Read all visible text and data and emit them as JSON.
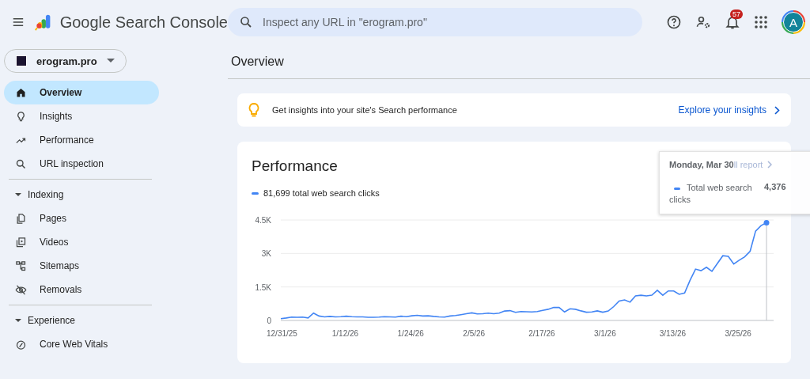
{
  "header": {
    "app_title": "Google Search Console",
    "search": {
      "placeholder": "Inspect any URL in \"erogram.pro\""
    },
    "notifications": {
      "count": "57"
    },
    "avatar": {
      "initial": "A"
    }
  },
  "sidebar": {
    "property": "erogram.pro",
    "items": [
      {
        "label": "Overview",
        "selected": true
      },
      {
        "label": "Insights",
        "selected": false
      },
      {
        "label": "Performance",
        "selected": false
      },
      {
        "label": "URL inspection",
        "selected": false
      }
    ],
    "sections": [
      {
        "title": "Indexing",
        "expanded": true,
        "items": [
          {
            "label": "Pages",
            "selected": false
          },
          {
            "label": "Videos",
            "selected": false
          },
          {
            "label": "Sitemaps",
            "selected": false
          },
          {
            "label": "Removals",
            "selected": false
          }
        ]
      },
      {
        "title": "Experience",
        "expanded": true,
        "items": [
          {
            "label": "Core Web Vitals",
            "selected": false
          }
        ]
      }
    ]
  },
  "page": {
    "title": "Overview",
    "insight_banner": {
      "text": "Get insights into your site's Search performance",
      "link": "Explore your insights"
    },
    "performance": {
      "title": "Performance",
      "partial_link": "ll report",
      "legend": "81,699 total web search clicks",
      "chart_data": {
        "type": "line",
        "categories": [
          "12/31/25",
          null,
          null,
          null,
          null,
          null,
          null,
          null,
          null,
          null,
          null,
          null,
          "1/12/26",
          null,
          null,
          null,
          null,
          null,
          null,
          null,
          null,
          null,
          null,
          null,
          "1/24/26",
          null,
          null,
          null,
          null,
          null,
          null,
          null,
          null,
          null,
          null,
          null,
          "2/5/26",
          null,
          null,
          null,
          null,
          null,
          null,
          null,
          null,
          null,
          null,
          null,
          "2/17/26",
          null,
          null,
          null,
          null,
          null,
          null,
          null,
          null,
          null,
          null,
          null,
          "3/1/26",
          null,
          null,
          null,
          null,
          null,
          null,
          null,
          null,
          null,
          null,
          null,
          "3/13/26",
          null,
          null,
          null,
          null,
          null,
          null,
          null,
          null,
          null,
          null,
          null,
          "3/25/26",
          null,
          null,
          null,
          null,
          null
        ],
        "ylim": [
          0,
          4500
        ],
        "yticks": [
          0,
          {
            "value": 1500,
            "label": "1.5K"
          },
          {
            "value": 3000,
            "label": "3K"
          },
          {
            "value": 4500,
            "label": "4.5K"
          }
        ],
        "series": [
          {
            "name": "Total web search clicks",
            "color": "#4285f4",
            "values": [
              80,
              110,
              150,
              140,
              150,
              110,
              330,
              200,
              160,
              180,
              160,
              170,
              190,
              170,
              160,
              160,
              140,
              140,
              150,
              170,
              160,
              150,
              190,
              170,
              210,
              230,
              200,
              210,
              180,
              160,
              150,
              200,
              220,
              260,
              300,
              340,
              290,
              300,
              330,
              300,
              330,
              420,
              440,
              360,
              400,
              390,
              380,
              400,
              450,
              500,
              580,
              580,
              380,
              520,
              500,
              430,
              370,
              380,
              430,
              370,
              420,
              620,
              870,
              920,
              820,
              1100,
              1130,
              1100,
              1130,
              1350,
              1130,
              1320,
              1320,
              1170,
              1230,
              1800,
              2300,
              2230,
              2380,
              2200,
              2550,
              2900,
              2870,
              2530,
              2700,
              2850,
              3100,
              4000,
              4250,
              4376
            ]
          }
        ]
      },
      "tooltip": {
        "date": "Monday, Mar 30",
        "value": "4,376"
      }
    }
  }
}
